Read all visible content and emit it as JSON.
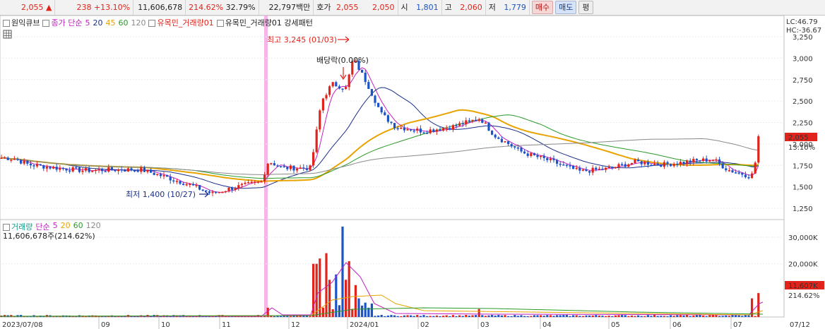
{
  "toolbar": {
    "price": "2,055",
    "arrow": "▲",
    "change": "238",
    "change_pct": "+13.10%",
    "volume": "11,606,678",
    "volume_pct": "214.62%",
    "turnover_pct": "32.79%",
    "amount": "22,797백만",
    "quote_label": "호가",
    "ask": "2,055",
    "bid": "2,050",
    "open_label": "시",
    "open": "1,801",
    "high_label": "고",
    "high": "2,060",
    "low_label": "저",
    "low": "1,779",
    "buy_label": "매수",
    "sell_label": "매도",
    "flat_label": "평"
  },
  "legend": {
    "stock_name": "원익큐브",
    "ma_label": "종가 단순",
    "ma_periods": [
      "5",
      "20",
      "45",
      "60",
      "120"
    ],
    "indicator1": "유목민_거래량01",
    "indicator2": "유목민_거래량01 강세패턴"
  },
  "price_panel": {
    "lc_label": "LC:46.79",
    "hc_label": "HC:-36.67",
    "y_ticks": [
      "3,250",
      "3,000",
      "2,750",
      "2,500",
      "2,250",
      "2,000",
      "1,750",
      "1,500",
      "1,250"
    ],
    "y_values": [
      3250,
      3000,
      2750,
      2500,
      2250,
      2000,
      1750,
      1500,
      1250
    ],
    "current_tag": "2,055",
    "current_pct_tag": "13.10%",
    "high_annotation": "최고 3,245 (01/03)",
    "low_annotation": "최저 1,400 (10/27)",
    "dividend_annotation": "배당락(0.00%)"
  },
  "volume_panel": {
    "legend_label": "거래량",
    "ma_label": "단순",
    "ma_periods": [
      "5",
      "20",
      "60",
      "120"
    ],
    "info": "11,606,678주(214.62%)",
    "y_ticks": [
      "30,000K",
      "20,000K"
    ],
    "current_tag": "11,607K",
    "current_pct_tag": "214.62%"
  },
  "x_axis": {
    "labels": [
      "2023/07/08",
      "09",
      "10",
      "11",
      "12",
      "2024/01",
      "02",
      "03",
      "04",
      "05",
      "06",
      "07",
      "07/12"
    ]
  },
  "colors": {
    "up": "#e0241b",
    "down": "#1c54c8",
    "ma5": "#c21fc2",
    "ma20": "#1a2f8a",
    "ma45": "#e8a300",
    "ma60": "#2a9a2a",
    "ma120": "#8a8a8a",
    "highlight": "#f5b5e8"
  }
}
